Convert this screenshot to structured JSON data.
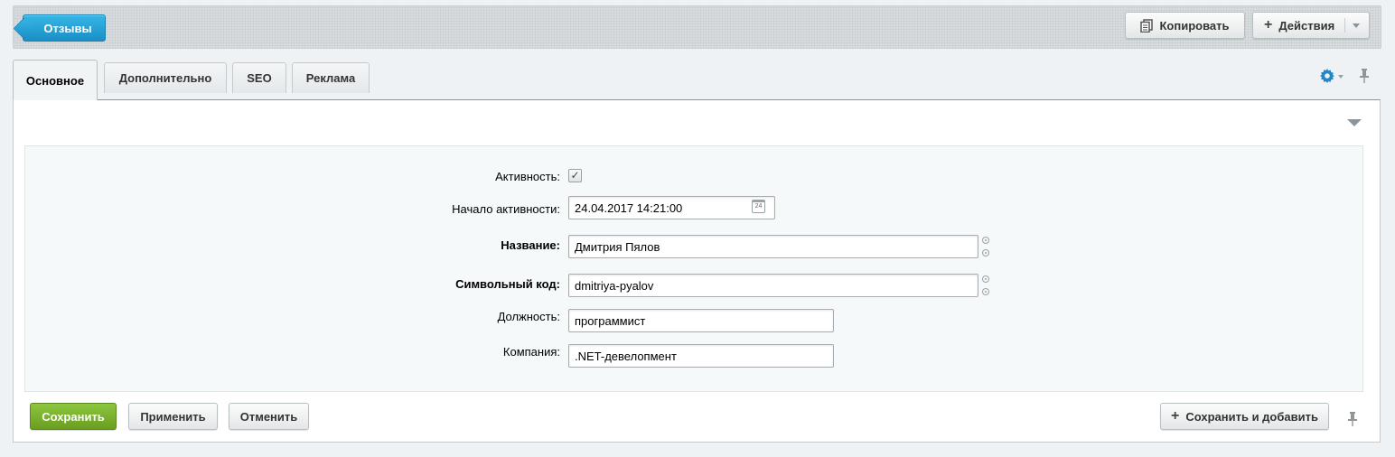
{
  "header": {
    "back_label": "Отзывы",
    "copy_label": "Копировать",
    "actions_label": "Действия"
  },
  "tabs": [
    {
      "label": "Основное",
      "active": true
    },
    {
      "label": "Дополнительно",
      "active": false
    },
    {
      "label": "SEO",
      "active": false
    },
    {
      "label": "Реклама",
      "active": false
    }
  ],
  "form": {
    "active": {
      "label": "Активность:",
      "checked": true
    },
    "active_from": {
      "label": "Начало активности:",
      "value": "24.04.2017 14:21:00",
      "calendar_icon_text": "24"
    },
    "name": {
      "label": "Название:",
      "value": "Дмитрия Пялов"
    },
    "code": {
      "label": "Символьный код:",
      "value": "dmitriya-pyalov"
    },
    "position": {
      "label": "Должность:",
      "value": "программист"
    },
    "company": {
      "label": "Компания:",
      "value": ".NET-девелопмент"
    }
  },
  "footer": {
    "save_label": "Сохранить",
    "apply_label": "Применить",
    "cancel_label": "Отменить",
    "save_add_label": "Сохранить и добавить"
  },
  "icons": {
    "gear": "gear-icon",
    "pin": "pin-icon",
    "copy": "copy-icon",
    "plus": "plus-icon",
    "calendar": "calendar-icon",
    "translit": "translit-icon"
  },
  "colors": {
    "back_button": "#1b8fc6",
    "save_button": "#6a9e1f",
    "gear": "#2586c6"
  }
}
